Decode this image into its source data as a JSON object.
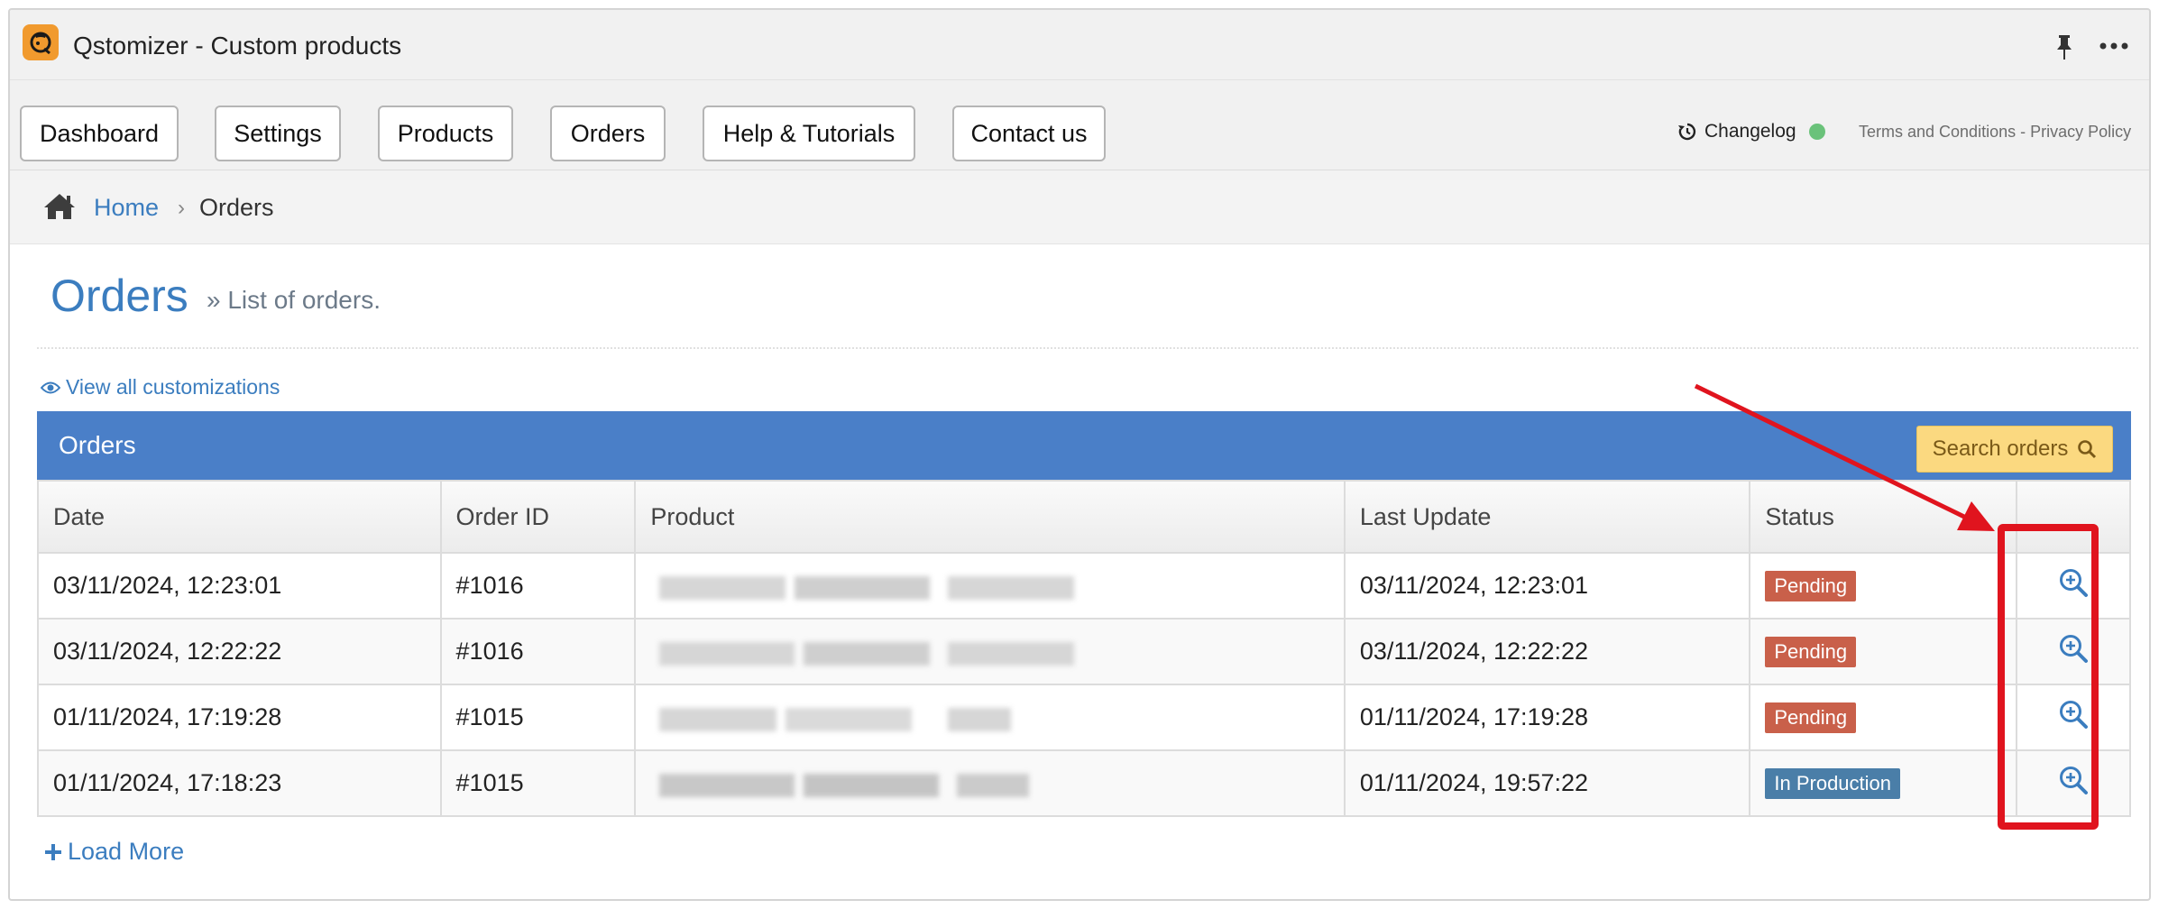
{
  "app": {
    "title": "Qstomizer - Custom products",
    "icon": "qstomizer-logo-icon"
  },
  "window_icons": {
    "pin": "pin-icon",
    "more": "more-options-icon"
  },
  "nav": {
    "buttons": [
      {
        "label": "Dashboard"
      },
      {
        "label": "Settings"
      },
      {
        "label": "Products"
      },
      {
        "label": "Orders"
      },
      {
        "label": "Help & Tutorials"
      },
      {
        "label": "Contact us"
      }
    ],
    "changelog": {
      "label": "Changelog",
      "icon": "history-icon",
      "indicator_color": "#6ac27a"
    },
    "terms": "Terms and Conditions",
    "separator": "-",
    "privacy": "Privacy Policy"
  },
  "breadcrumb": {
    "home": "Home",
    "separator": "›",
    "current": "Orders"
  },
  "page": {
    "title": "Orders",
    "subtitle": "» List of orders."
  },
  "view_all": {
    "label": "View all customizations",
    "icon": "eye-icon"
  },
  "panel": {
    "title": "Orders",
    "header_color": "#4a7fc8",
    "search_label": "Search orders",
    "search_icon": "search-icon"
  },
  "table": {
    "columns": [
      "Date",
      "Order ID",
      "Product",
      "Last Update",
      "Status",
      ""
    ],
    "rows": [
      {
        "date": "03/11/2024, 12:23:01",
        "order_id": "#1016",
        "last_update": "03/11/2024, 12:23:01",
        "status": "Pending"
      },
      {
        "date": "03/11/2024, 12:22:22",
        "order_id": "#1016",
        "last_update": "03/11/2024, 12:22:22",
        "status": "Pending"
      },
      {
        "date": "01/11/2024, 17:19:28",
        "order_id": "#1015",
        "last_update": "01/11/2024, 17:19:28",
        "status": "Pending"
      },
      {
        "date": "01/11/2024, 17:18:23",
        "order_id": "#1015",
        "last_update": "01/11/2024, 19:57:22",
        "status": "In Production"
      }
    ],
    "status_colors": {
      "Pending": "#c9604a",
      "In Production": "#4a7ea8"
    },
    "row_action_icon": "zoom-in-icon"
  },
  "load_more": {
    "label": "Load More",
    "icon": "plus-icon"
  },
  "annotation": {
    "color": "#e0141e"
  }
}
